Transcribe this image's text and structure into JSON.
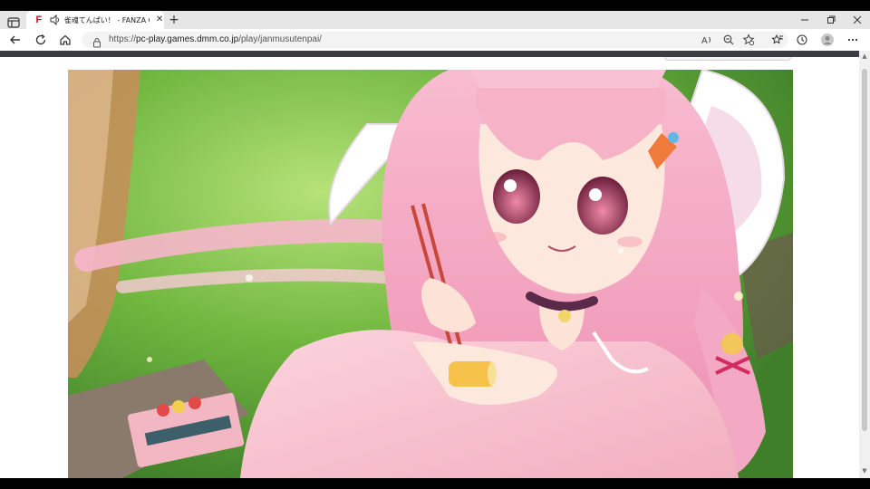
{
  "browser": {
    "tab": {
      "title": "雀魂てんぱい！ - FANZA GAMES",
      "favicon_letter": "F",
      "favicon_color": "#d40b22"
    },
    "new_tab_symbol": "+",
    "url_prefix": "https://",
    "url_host": "pc-play.games.dmm.co.jp",
    "url_path": "/play/janmusutenpai/",
    "icons": [
      "tab-actions-icon",
      "speaker-icon",
      "close-icon",
      "new-tab-icon",
      "minimize-icon",
      "maximize-icon",
      "window-close-icon",
      "back-icon",
      "refresh-icon",
      "home-icon",
      "lock-icon",
      "read-aloud-icon",
      "zoom-icon",
      "favorite-add-icon",
      "favorites-icon",
      "history-icon",
      "profile-icon",
      "more-icon"
    ]
  },
  "colors": {
    "accent": "#d40b22",
    "hair": "#f3a9c3",
    "grass": "#6cae3a"
  }
}
